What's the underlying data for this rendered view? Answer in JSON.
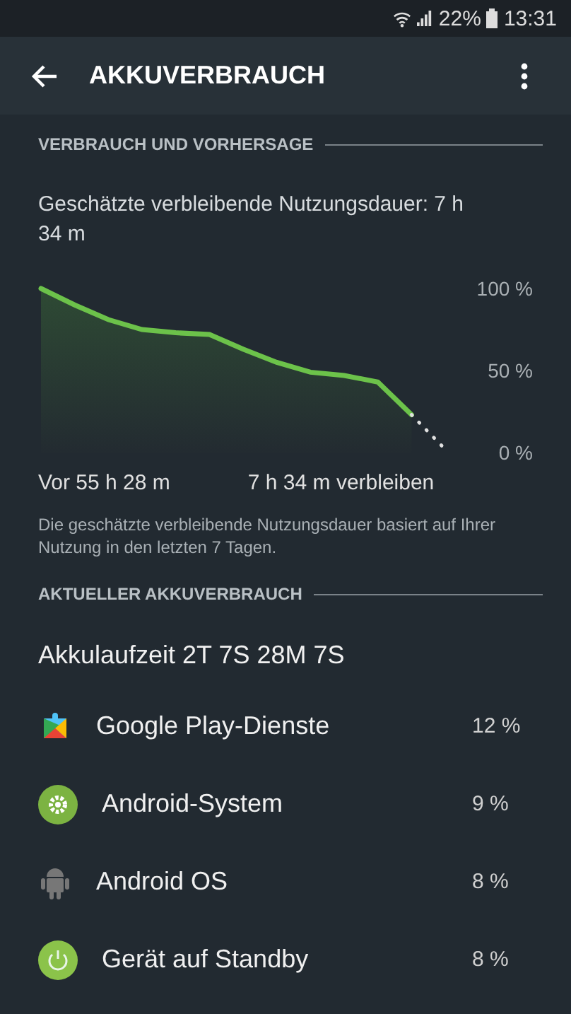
{
  "status_bar": {
    "battery": "22%",
    "time": "13:31"
  },
  "app_bar": {
    "title": "AKKUVERBRAUCH"
  },
  "forecast": {
    "header": "VERBRAUCH UND VORHERSAGE",
    "estimate": "Geschätzte verbleibende Nutzungsdauer: 7 h 34 m",
    "chart_data": {
      "type": "area",
      "categories": [
        null,
        null,
        null,
        null,
        null,
        null,
        null,
        null,
        null,
        null,
        null,
        null,
        null
      ],
      "ylim": [
        0,
        100
      ],
      "yticks": [
        {
          "value": 100,
          "label": "100 %"
        },
        {
          "value": 50,
          "label": "50 %"
        },
        {
          "value": 0,
          "label": "0 %"
        }
      ],
      "series": [
        {
          "color": "#6cc24a",
          "values": [
            100,
            90,
            81,
            75,
            73,
            72,
            63,
            55,
            49,
            47,
            43,
            23,
            null
          ]
        },
        {
          "color": "#e0e0e0",
          "type": "line",
          "line_style": "dotted",
          "values": [
            null,
            null,
            null,
            null,
            null,
            null,
            null,
            null,
            null,
            null,
            null,
            23,
            2
          ]
        }
      ]
    },
    "since": "Vor 55 h 28 m",
    "remaining": "7 h 34 m verbleiben",
    "note": "Die geschätzte verbleibende Nutzungsdauer basiert auf Ihrer Nutzung in den letzten 7 Tagen."
  },
  "usage": {
    "header": "AKTUELLER AKKUVERBRAUCH",
    "runtime": "Akkulaufzeit 2T 7S 28M 7S",
    "apps": [
      {
        "kind": "play",
        "name": "Google Play-Dienste",
        "percent": "12 %"
      },
      {
        "kind": "system",
        "name": "Android-System",
        "percent": "9 %"
      },
      {
        "kind": "android",
        "name": "Android OS",
        "percent": "8 %"
      },
      {
        "kind": "standby",
        "name": "Gerät auf Standby",
        "percent": "8 %"
      }
    ]
  }
}
